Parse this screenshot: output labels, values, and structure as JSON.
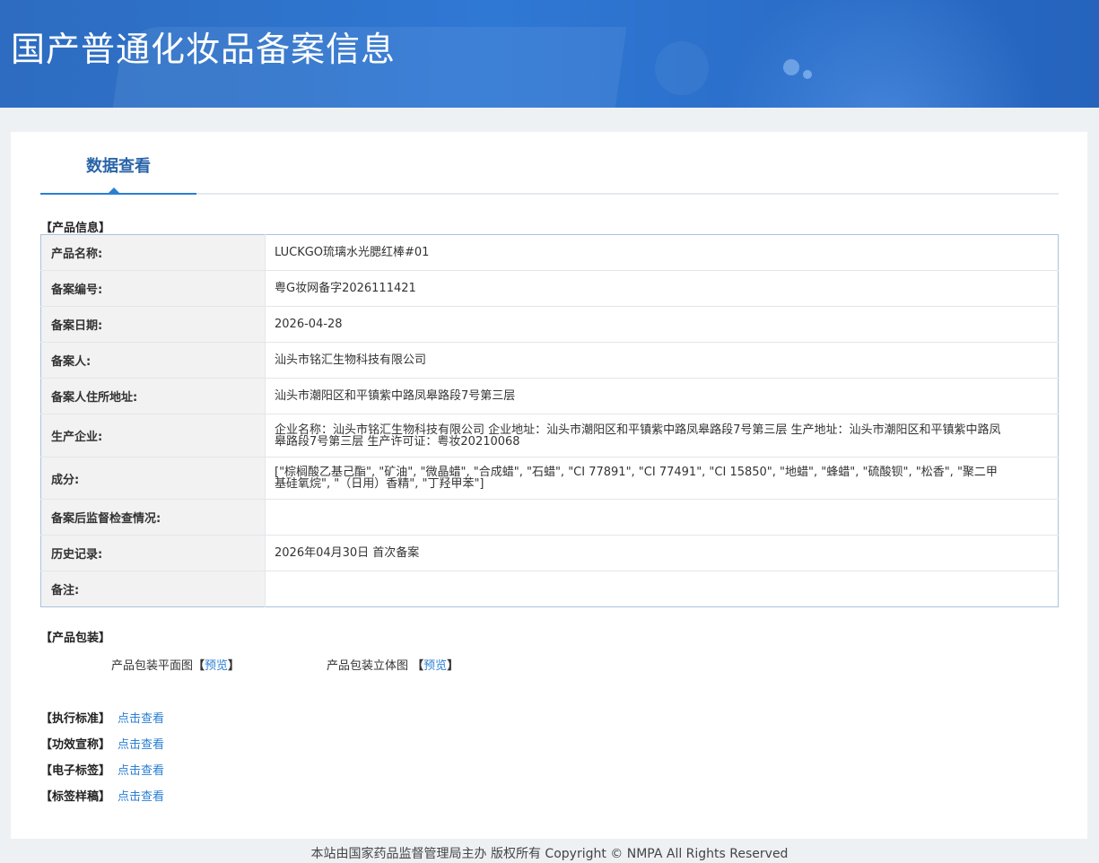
{
  "header": {
    "title": "国产普通化妆品备案信息"
  },
  "tabs": [
    {
      "label": "数据查看"
    }
  ],
  "product_info": {
    "section_title": "【产品信息】",
    "rows": [
      {
        "label": "产品名称:",
        "value": "LUCKGO琉璃水光腮红棒#01"
      },
      {
        "label": "备案编号:",
        "value": "粤G妆网备字2026111421"
      },
      {
        "label": "备案日期:",
        "value": "2026-04-28"
      },
      {
        "label": "备案人:",
        "value": "汕头市铭汇生物科技有限公司"
      },
      {
        "label": "备案人住所地址:",
        "value": "汕头市潮阳区和平镇紫中路凤皋路段7号第三层"
      },
      {
        "label": "生产企业:",
        "value": "企业名称：汕头市铭汇生物科技有限公司 企业地址：汕头市潮阳区和平镇紫中路凤皋路段7号第三层 生产地址：汕头市潮阳区和平镇紫中路凤皋路段7号第三层 生产许可证：粤妆20210068"
      },
      {
        "label": "成分:",
        "value": "[\"棕榈酸乙基己酯\", \"矿油\", \"微晶蜡\", \"合成蜡\", \"石蜡\", \"CI 77891\", \"CI 77491\", \"CI 15850\", \"地蜡\", \"蜂蜡\", \"硫酸钡\", \"松香\", \"聚二甲基硅氧烷\", \"（日用）香精\", \"丁羟甲苯\"]"
      },
      {
        "label": "备案后监督检查情况:",
        "value": ""
      },
      {
        "label": "历史记录:",
        "value": "2026年04月30日 首次备案"
      },
      {
        "label": "备注:",
        "value": ""
      }
    ]
  },
  "packaging": {
    "section_title": "【产品包装】",
    "flat_label": "产品包装平面图",
    "solid_label": "产品包装立体图",
    "bracket_open": "【",
    "bracket_close": "】",
    "preview_link": "预览"
  },
  "extras": [
    {
      "label": "【执行标准】",
      "link": "点击查看"
    },
    {
      "label": "【功效宣称】",
      "link": "点击查看"
    },
    {
      "label": "【电子标签】",
      "link": "点击查看"
    },
    {
      "label": "【标签样稿】",
      "link": "点击查看"
    }
  ],
  "footer": {
    "text": "本站由国家药品监督管理局主办 版权所有 Copyright © NMPA All Rights Reserved"
  },
  "colors": {
    "banner": "#2f78d4",
    "link": "#2a7fd4",
    "tab_text": "#2a64a8",
    "table_border": "#a9c3de"
  }
}
